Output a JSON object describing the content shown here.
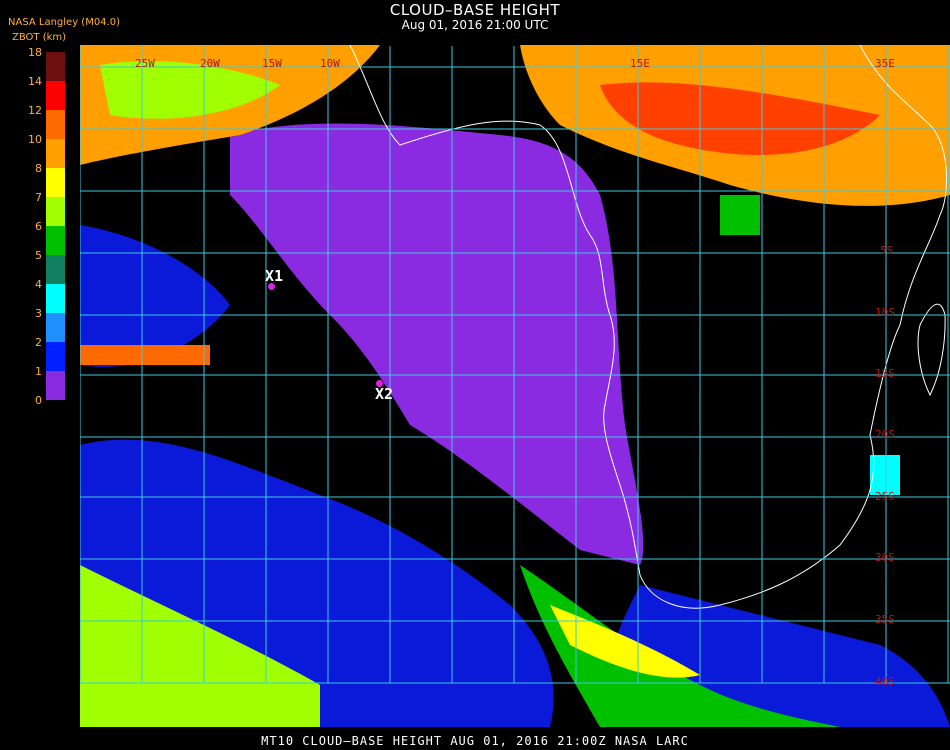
{
  "header": {
    "title": "CLOUD–BASE HEIGHT",
    "subtitle": "Aug 01, 2016 21:00 UTC",
    "org": "NASA Langley (M04.0)",
    "unit": "ZBOT (km)"
  },
  "legend": {
    "ticks": [
      "18",
      "14",
      "12",
      "10",
      "8",
      "7",
      "6",
      "5",
      "4",
      "3",
      "2",
      "1",
      "0"
    ],
    "colors": [
      "#6e1010",
      "#ff0000",
      "#ff6a00",
      "#ffa000",
      "#ffff00",
      "#a0ff00",
      "#00c000",
      "#108060",
      "#00ffff",
      "#2090ff",
      "#0020ff",
      "#8a2be2"
    ]
  },
  "map": {
    "lat_labels": [
      "5S",
      "10S",
      "15S",
      "20S",
      "25S",
      "30S",
      "35S",
      "40S"
    ],
    "lon_labels": [
      "25W",
      "20W",
      "15W",
      "10W",
      "15E",
      "35E"
    ],
    "markers": [
      {
        "label": "X1"
      },
      {
        "label": "X2"
      }
    ]
  },
  "footer": "MT10   CLOUD–BASE HEIGHT   AUG 01, 2016 21:00Z   NASA LARC"
}
